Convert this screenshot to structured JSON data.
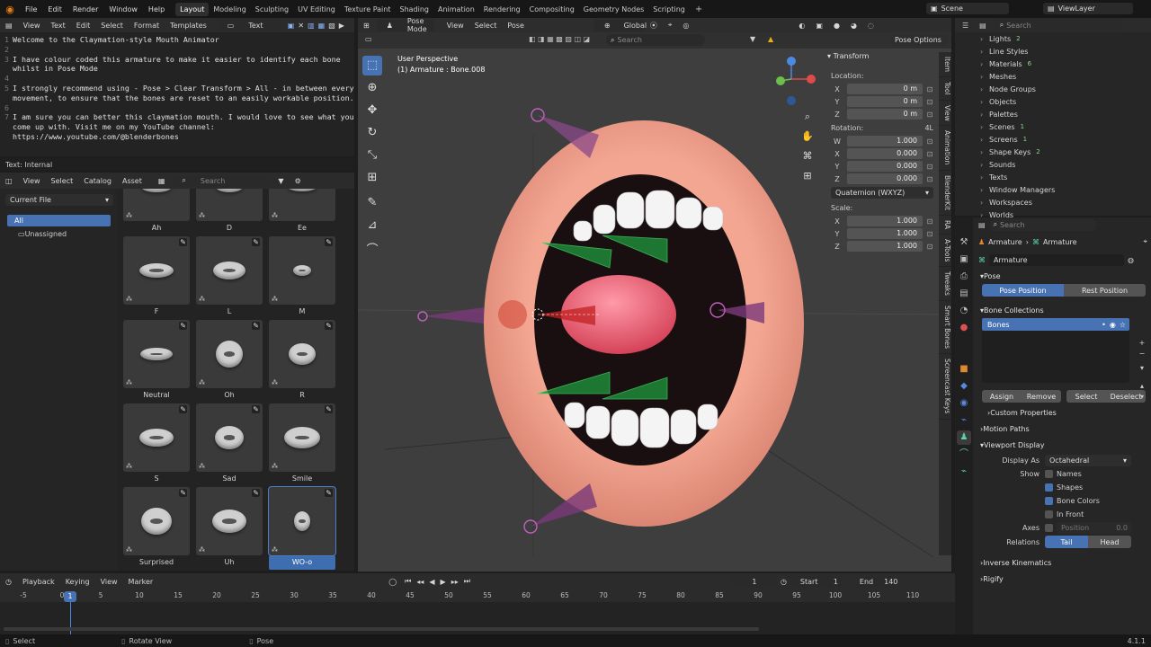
{
  "topbar": {
    "menus": [
      "File",
      "Edit",
      "Render",
      "Window",
      "Help"
    ],
    "workspaces": [
      "Layout",
      "Modeling",
      "Sculpting",
      "UV Editing",
      "Texture Paint",
      "Shading",
      "Animation",
      "Rendering",
      "Compositing",
      "Geometry Nodes",
      "Scripting"
    ],
    "active": "Layout",
    "scene": "Scene",
    "viewlayer": "ViewLayer"
  },
  "texteditor": {
    "menus": [
      "View",
      "Text",
      "Edit",
      "Select",
      "Format",
      "Templates"
    ],
    "name": "Text",
    "lines": [
      {
        "n": "1",
        "t": "Welcome to the Claymation-style Mouth Animator"
      },
      {
        "n": "2",
        "t": ""
      },
      {
        "n": "3",
        "t": "I have colour coded this armature to make it easier to identify each bone"
      },
      {
        "n": "",
        "t": "whilst in Pose Mode"
      },
      {
        "n": "4",
        "t": ""
      },
      {
        "n": "5",
        "t": "I strongly recommend using - Pose > Clear Transform > All - in between every"
      },
      {
        "n": "",
        "t": "movement, to ensure that the bones are reset to an easily workable position."
      },
      {
        "n": "6",
        "t": ""
      },
      {
        "n": "7",
        "t": "I am sure you can better this claymation mouth. I would love to see what you"
      },
      {
        "n": "",
        "t": "come up with. Visit me on my YouTube channel:"
      },
      {
        "n": "",
        "t": "https://www.youtube.com/@blenderbones"
      }
    ],
    "footer": "Text: Internal"
  },
  "asset": {
    "menus": [
      "View",
      "Select",
      "Catalog",
      "Asset"
    ],
    "search": "Search",
    "library": "Current File",
    "catalogs": [
      {
        "label": "All",
        "active": true
      },
      {
        "label": "Unassigned",
        "active": false
      }
    ],
    "tiles": [
      {
        "label": "Ah",
        "w": 34,
        "h": 12
      },
      {
        "label": "D",
        "w": 30,
        "h": 12
      },
      {
        "label": "Ee",
        "w": 32,
        "h": 10
      },
      {
        "label": "F",
        "w": 38,
        "h": 16
      },
      {
        "label": "L",
        "w": 36,
        "h": 20
      },
      {
        "label": "M",
        "w": 20,
        "h": 12
      },
      {
        "label": "Neutral",
        "w": 36,
        "h": 14
      },
      {
        "label": "Oh",
        "w": 30,
        "h": 30
      },
      {
        "label": "R",
        "w": 30,
        "h": 24
      },
      {
        "label": "S",
        "w": 38,
        "h": 20
      },
      {
        "label": "Sad",
        "w": 32,
        "h": 26
      },
      {
        "label": "Smile",
        "w": 40,
        "h": 24
      },
      {
        "label": "Surprised",
        "w": 34,
        "h": 30
      },
      {
        "label": "Uh",
        "w": 38,
        "h": 26
      },
      {
        "label": "WO-o",
        "w": 18,
        "h": 22,
        "sel": true
      }
    ]
  },
  "viewport": {
    "menus": [
      "Pose Mode",
      "View",
      "Select",
      "Pose"
    ],
    "orientation": "Global",
    "search": "Search",
    "options": "Pose Options",
    "perspective": "User Perspective",
    "object": "(1) Armature : Bone.008"
  },
  "npanel": {
    "title": "Transform",
    "location_label": "Location:",
    "location": [
      {
        "a": "X",
        "v": "0 m"
      },
      {
        "a": "Y",
        "v": "0 m"
      },
      {
        "a": "Z",
        "v": "0 m"
      }
    ],
    "rotation_label": "Rotation:",
    "rotation_mode_badge": "4L",
    "rotation": [
      {
        "a": "W",
        "v": "1.000"
      },
      {
        "a": "X",
        "v": "0.000"
      },
      {
        "a": "Y",
        "v": "0.000"
      },
      {
        "a": "Z",
        "v": "0.000"
      }
    ],
    "rotation_mode": "Quaternion (WXYZ)",
    "scale_label": "Scale:",
    "scale": [
      {
        "a": "X",
        "v": "1.000"
      },
      {
        "a": "Y",
        "v": "1.000"
      },
      {
        "a": "Z",
        "v": "1.000"
      }
    ]
  },
  "sidetabs": [
    "Item",
    "Tool",
    "View",
    "Animation",
    "BlenderKit",
    "RA",
    "A-Tools",
    "Tweaks",
    "Smart Bones",
    "Screencast Keys"
  ],
  "outliner": {
    "search": "Search",
    "items": [
      "Lights",
      "Line Styles",
      "Materials",
      "Meshes",
      "Node Groups",
      "Objects",
      "Palettes",
      "Scenes",
      "Screens",
      "Shape Keys",
      "Sounds",
      "Texts",
      "Window Managers",
      "Workspaces",
      "Worlds"
    ],
    "counts": {
      "Lights": "2",
      "Materials": "6",
      "Scenes": "1",
      "Screens": "1",
      "Shape Keys": "2"
    }
  },
  "props": {
    "search": "Search",
    "crumb1": "Armature",
    "crumb2": "Armature",
    "datablock": "Armature",
    "pose_section": "Pose",
    "pose_position": "Pose Position",
    "rest_position": "Rest Position",
    "bone_collections": "Bone Collections",
    "collection": "Bones",
    "assign": "Assign",
    "remove": "Remove",
    "select": "Select",
    "deselect": "Deselect",
    "custom_properties": "Custom Properties",
    "motion_paths": "Motion Paths",
    "viewport_display": "Viewport Display",
    "display_as_label": "Display As",
    "display_as": "Octahedral",
    "show_label": "Show",
    "names": "Names",
    "shapes": "Shapes",
    "bone_colors": "Bone Colors",
    "in_front": "In Front",
    "axes_label": "Axes",
    "position": "Position",
    "position_val": "0.0",
    "relations_label": "Relations",
    "tail": "Tail",
    "head": "Head",
    "inverse_kinematics": "Inverse Kinematics",
    "rigify": "Rigify"
  },
  "timeline": {
    "menus": [
      "Playback",
      "Keying",
      "View",
      "Marker"
    ],
    "current": "1",
    "start_label": "Start",
    "start": "1",
    "end_label": "End",
    "end": "140",
    "ticks": [
      "-5",
      "0",
      "5",
      "10",
      "15",
      "20",
      "25",
      "30",
      "35",
      "40",
      "45",
      "50",
      "55",
      "60",
      "65",
      "70",
      "75",
      "80",
      "85",
      "90",
      "95",
      "100",
      "105",
      "110"
    ],
    "playhead": "1"
  },
  "status": {
    "select": "Select",
    "rotate": "Rotate View",
    "pose": "Pose",
    "version": "4.1.1"
  }
}
